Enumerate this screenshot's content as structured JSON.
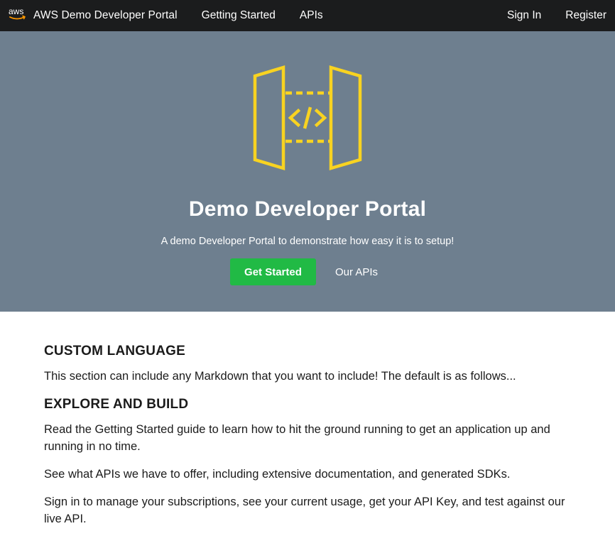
{
  "nav": {
    "brand": "AWS Demo Developer Portal",
    "logo_text": "aws",
    "links": [
      "Getting Started",
      "APIs"
    ],
    "sign_in": "Sign In",
    "register": "Register"
  },
  "hero": {
    "title": "Demo Developer Portal",
    "tagline": "A demo Developer Portal to demonstrate how easy it is to setup!",
    "primary_button": "Get Started",
    "secondary_button": "Our APIs",
    "icon": "api-gateway-icon"
  },
  "sections": [
    {
      "heading": "CUSTOM LANGUAGE",
      "paragraphs": [
        "This section can include any Markdown that you want to include! The default is as follows..."
      ]
    },
    {
      "heading": "EXPLORE AND BUILD",
      "paragraphs": [
        "Read the Getting Started guide to learn how to hit the ground running to get an application up and running in no time.",
        "See what APIs we have to offer, including extensive documentation, and generated SDKs.",
        "Sign in to manage your subscriptions, see your current usage, get your API Key, and test against our live API."
      ]
    }
  ],
  "colors": {
    "navbar": "#1b1c1d",
    "hero_bg": "#6e7f8f",
    "accent_green": "#21ba45",
    "icon_yellow": "#f8d321",
    "aws_orange": "#ff9900"
  }
}
